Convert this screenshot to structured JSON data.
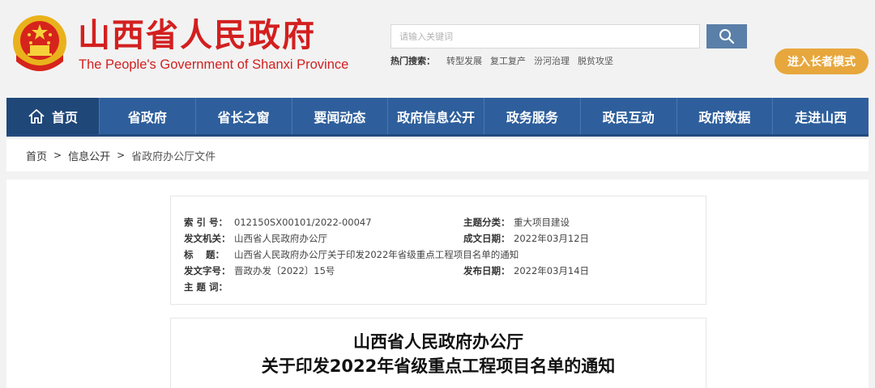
{
  "header": {
    "title": "山西省人民政府",
    "subtitle": "The People's Government of Shanxi Province",
    "search_placeholder": "请输入关键词",
    "hot_label": "热门搜索：",
    "hot_links": [
      "转型发展",
      "复工复产",
      "汾河治理",
      "脱贫攻坚"
    ],
    "elder_mode": "进入长者模式",
    "colors": {
      "brand_red": "#d31f1f",
      "nav_blue": "#2e5f9c",
      "elder_orange": "#e7a73d"
    }
  },
  "nav": {
    "home": "首页",
    "items": [
      "省政府",
      "省长之窗",
      "要闻动态",
      "政府信息公开",
      "政务服务",
      "政民互动",
      "政府数据",
      "走进山西"
    ]
  },
  "breadcrumb": {
    "items": [
      "首页",
      "信息公开",
      "省政府办公厅文件"
    ],
    "sep": ">"
  },
  "meta": {
    "index_label": "索 引 号：",
    "index_value": "012150SX00101/2022-00047",
    "category_label": "主题分类：",
    "category_value": "重大项目建设",
    "issuer_label": "发文机关：",
    "issuer_value": "山西省人民政府办公厅",
    "created_label": "成文日期：",
    "created_value": "2022年03月12日",
    "title_label": "标　 题：",
    "title_value": "山西省人民政府办公厅关于印发2022年省级重点工程项目名单的通知",
    "docno_label": "发文字号：",
    "docno_value": "晋政办发〔2022〕15号",
    "published_label": "发布日期：",
    "published_value": "2022年03月14日",
    "keywords_label": "主 题 词：",
    "keywords_value": ""
  },
  "document": {
    "title_line1": "山西省人民政府办公厅",
    "title_line2": "关于印发2022年省级重点工程项目名单的通知"
  }
}
